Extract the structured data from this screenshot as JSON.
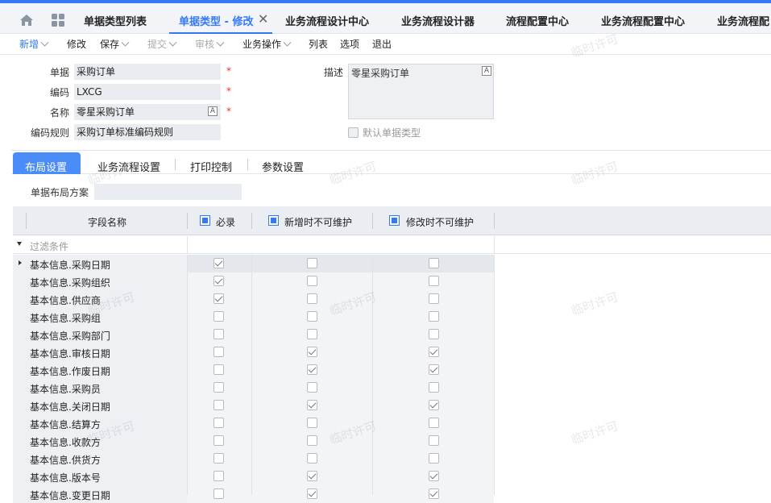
{
  "tabs": [
    {
      "label": "单据类型列表"
    },
    {
      "label": "单据类型 - 修改"
    },
    {
      "label": "业务流程设计中心"
    },
    {
      "label": "业务流程设计器"
    },
    {
      "label": "流程配置中心"
    },
    {
      "label": "业务流程配置中心"
    },
    {
      "label": "业务流程配"
    }
  ],
  "toolbar": {
    "new": "新增",
    "edit": "修改",
    "save": "保存",
    "submit": "提交",
    "audit": "审核",
    "biz_ops": "业务操作",
    "list": "列表",
    "options": "选项",
    "exit": "退出"
  },
  "form": {
    "bill_label": "单据",
    "bill_value": "采购订单",
    "code_label": "编码",
    "code_value": "LXCG",
    "name_label": "名称",
    "name_value": "零星采购订单",
    "rule_label": "编码规则",
    "rule_value": "采购订单标准编码规则",
    "desc_label": "描述",
    "desc_value": "零星采购订单",
    "default_label": "默认单据类型",
    "required_mark": "*",
    "lang_mark": "A"
  },
  "subtabs": {
    "layout": "布局设置",
    "flow": "业务流程设置",
    "print": "打印控制",
    "params": "参数设置"
  },
  "layout": {
    "scheme_label": "单据布局方案"
  },
  "grid": {
    "col_field": "字段名称",
    "col_required": "必录",
    "col_new_lock": "新增时不可维护",
    "col_edit_lock": "修改时不可维护",
    "filter_placeholder": "过滤条件",
    "rows": [
      {
        "name": "基本信息.采购日期",
        "required": true,
        "new_lock": false,
        "edit_lock": false
      },
      {
        "name": "基本信息.采购组织",
        "required": true,
        "new_lock": false,
        "edit_lock": false
      },
      {
        "name": "基本信息.供应商",
        "required": true,
        "new_lock": false,
        "edit_lock": false
      },
      {
        "name": "基本信息.采购组",
        "required": false,
        "new_lock": false,
        "edit_lock": false
      },
      {
        "name": "基本信息.采购部门",
        "required": false,
        "new_lock": false,
        "edit_lock": false
      },
      {
        "name": "基本信息.审核日期",
        "required": false,
        "new_lock": true,
        "edit_lock": true
      },
      {
        "name": "基本信息.作废日期",
        "required": false,
        "new_lock": true,
        "edit_lock": true
      },
      {
        "name": "基本信息.采购员",
        "required": false,
        "new_lock": false,
        "edit_lock": false
      },
      {
        "name": "基本信息.关闭日期",
        "required": false,
        "new_lock": true,
        "edit_lock": true
      },
      {
        "name": "基本信息.结算方",
        "required": false,
        "new_lock": false,
        "edit_lock": false
      },
      {
        "name": "基本信息.收款方",
        "required": false,
        "new_lock": false,
        "edit_lock": false
      },
      {
        "name": "基本信息.供货方",
        "required": false,
        "new_lock": false,
        "edit_lock": false
      },
      {
        "name": "基本信息.版本号",
        "required": false,
        "new_lock": true,
        "edit_lock": true
      },
      {
        "name": "基本信息.变更日期",
        "required": false,
        "new_lock": true,
        "edit_lock": true
      }
    ]
  },
  "watermark": "临时许可",
  "colors": {
    "accent": "#3478f6",
    "required": "#e33333"
  }
}
